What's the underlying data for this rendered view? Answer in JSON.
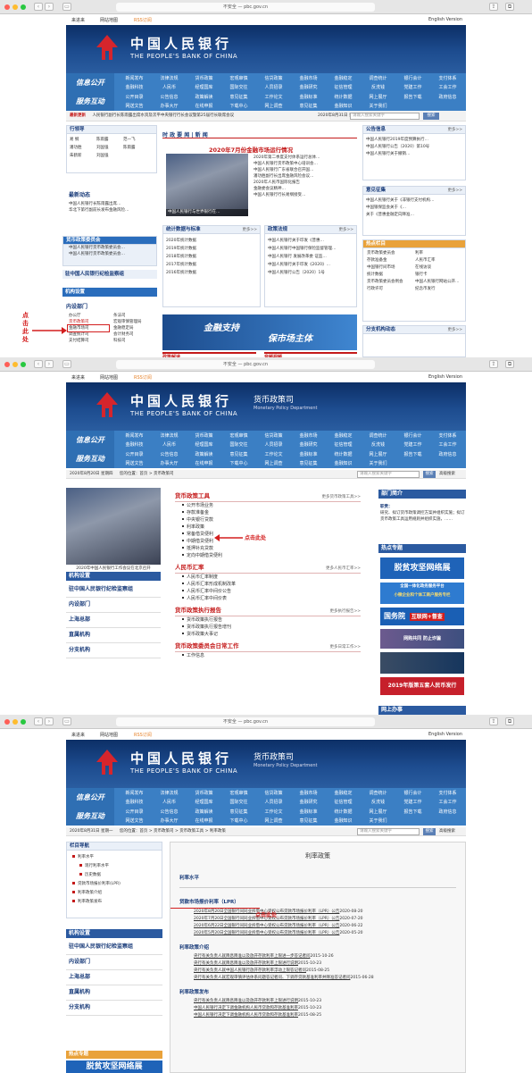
{
  "browser": {
    "url": "不安全 — pbc.gov.cn",
    "english": "English Version"
  },
  "toplinks": {
    "visit": "来进来",
    "sitemap": "网站地图",
    "rss": "RSS订阅",
    "english": "English Version"
  },
  "brand": {
    "cn": "中国人民银行",
    "en": "THE PEOPLE'S BANK OF CHINA",
    "dept_cn": "货币政策司",
    "dept_en": "Monetary Policy Department"
  },
  "menu": {
    "label1": "信息公开",
    "label2": "服务互动",
    "row1": [
      "新闻发布",
      "法律法规",
      "货币政策",
      "宏观审慎",
      "信贷政策",
      "金融市场",
      "金融稳定",
      "调查统计",
      "银行会计",
      "支付体系"
    ],
    "row2": [
      "金融科技",
      "人民币",
      "经理国库",
      "国际交往",
      "人员招录",
      "金融研究",
      "征信管理",
      "反洗钱",
      "党建工作",
      "工会工作"
    ],
    "row3": [
      "公开目录",
      "公告信息",
      "政策解读",
      "意见征集",
      "工作论文",
      "金融标准",
      "统计数据",
      "网上展厅",
      "报告下载",
      "政府信息"
    ],
    "row4": [
      "网送文告",
      "办事大厅",
      "在线申报",
      "下载中心",
      "网上调查",
      "意见征集",
      "金融知识",
      "关于我们",
      "",
      ""
    ]
  },
  "s1": {
    "ticker_label": "最新更新",
    "ticker": "人民银行副行长陈雨露出席水资及次平中央银行行长会议暨第25届行长联席会议",
    "ticker_date": "2020年8月31日 星期一",
    "search_placeholder": "请输入搜索关键字",
    "search_btn": "搜索",
    "leaders_title": "行领导",
    "leaders": [
      "易 纲",
      "陈雨露",
      "范一飞",
      "潘功胜",
      "刘国强",
      "陈雨露",
      "朱鹤新",
      "刘国强"
    ],
    "latest_title": "最新动态",
    "latest": [
      "中国人民银行长陈雨露出席…",
      "华北下第行副前长发布金融风险…"
    ],
    "mpc_title": "货币政策委员会",
    "mpc": [
      "中国人民银行货币政策委员会…",
      "中国人民银行货币政策委员会…"
    ],
    "jijian": "驻中国人民银行纪检监察组",
    "jigou_title": "机构设置",
    "neibu": "内设部门",
    "dept_grid": [
      "办公厅",
      "条法司",
      "货币政策司",
      "宏观审慎管理局",
      "金融市场司",
      "金融稳定局",
      "调查统计司",
      "会计财务司",
      "支付结算司",
      "科技司"
    ],
    "highlight_dept": "货币政策司",
    "annot1": "点击此处",
    "news_title": "时 政 要 闻 | 新 闻",
    "news_headline": "2020年7月份金融市场运行情况",
    "news_list": [
      "2020年第二季度支付体系运行总体…",
      "中国人民银行货币政策中心培训会…",
      "中国人民银行广东省联合召开国…",
      "潘功胜副行长出席金融风险会议…",
      "2020年人民币国际化报告",
      "金融委会议精神…",
      "中国人民银行行长易纲接受…"
    ],
    "photo_caption": "中国人民银行与世界银行在…",
    "stats_title": "统计数据与标准",
    "stats": [
      "2020年统计数据",
      "2019年统计数据",
      "2018年统计数据",
      "2017年统计数据",
      "2016年统计数据"
    ],
    "law_title": "政策法规",
    "law": [
      "中国人民银行关于印发《普惠…",
      "中国人民银行中国银行保险监督管理…",
      "中国人民银行 发展改革委 证监…",
      "中国人民银行关于印发《2020》…",
      "中国人民银行公告〔2020〕1号"
    ],
    "banner_text1": "金融支持",
    "banner_text2": "保市场主体",
    "gongkai_title": "公告信息",
    "gongkai": [
      "中国人民银行2019年度预算执行…",
      "中国人民银行公告〔2020〕第10号",
      "中国人民银行关于撤销…"
    ],
    "yijian_title": "意见征集",
    "yijian": [
      "中国人民银行关于《非银行支付机构…",
      "中国银保监会关于《…",
      "关于《普惠金融定向降准…"
    ],
    "hot_title": "热点栏目",
    "hot": [
      "货币政策委员会",
      "利率",
      "存款准备金",
      "人民币汇率",
      "中国银行间市场",
      "在线访谈",
      "统计数据",
      "银行卡",
      "货币政策委员会例会",
      "中国人民银行网站公开…",
      "行政许可",
      "纪念币发行"
    ],
    "fenzhi_title": "分支机构动态",
    "zhengce": "政策解读",
    "shipin": "音频视频"
  },
  "s2": {
    "date": "2020年8月20日 星期四",
    "crumb": "您的位置：首页 > 货币政策司",
    "search_placeholder": "请输入搜索关键字",
    "search_btn": "搜索",
    "adv": "高级搜索",
    "photo_caption": "2020年中国人民银行工作会议在北京召开",
    "side": [
      "机构设置",
      "驻中国人民银行纪检监察组",
      "内设部门",
      "上海总部",
      "直属机构",
      "分支机构"
    ],
    "tools_title": "货币政策工具",
    "tools_more": "更多货币政策工具>>",
    "tools": [
      "公开市场业务",
      "存款准备金",
      "中央银行贷款",
      "利率政策",
      "常备借贷便利",
      "中期借贷便利",
      "抵押补充贷款",
      "定向中期借贷便利"
    ],
    "annot2": "点击此处",
    "rmb_title": "人民币汇率",
    "rmb_more": "更多人民币汇率>>",
    "rmb": [
      "人民币汇率制度",
      "人民币汇率形成机制改革",
      "人民币汇率中间价公告",
      "人民币汇率中间价表"
    ],
    "report_title": "货币政策执行报告",
    "report_more": "更多执行报告>>",
    "report": [
      "货币政策执行报告",
      "货币政策执行报告增刊",
      "货币政策大事记"
    ],
    "committee_title": "货币政策委员会日常工作",
    "committee_more": "更多日常工作>>",
    "committee": [
      "工作信息"
    ],
    "dept_intro_title": "部门简介",
    "dept_intro_label": "职责：",
    "dept_intro_text": "研究、拟订货币政策调控方案并组织实施；拟订货币政策工具运用规则并组织实施，……",
    "hot_title": "热点专题",
    "promo1": "脱贫攻坚网络展",
    "promo2a": "全国一体化政务服务平台",
    "promo2b": "小微企业和个体工商户服务专栏",
    "promo3": "国务院",
    "promo3b": "互联网+督查",
    "promo4": "网购共同 防止诈骗",
    "promo5": "2019年版第五套人民币发行",
    "wangshang": "网上办事"
  },
  "s3": {
    "date": "2020年8月31日 星期一",
    "crumb": "您的位置：首页 > 货币政策司 > 货币政策工具 > 利率政策",
    "search_placeholder": "请输入搜索关键字",
    "search_btn": "搜索",
    "adv": "高级搜索",
    "nav_title": "栏目导航",
    "nav": [
      "利率水平",
      "现行利率水平",
      "历史数据",
      "贷款市场报价利率(LPR)",
      "利率政策介绍",
      "利率政策发布"
    ],
    "side": [
      "机构设置",
      "驻中国人民银行纪检监察组",
      "内设部门",
      "上海总部",
      "直属机构",
      "分支机构"
    ],
    "hot_title": "热点专题",
    "promo": "脱贫攻坚网络展",
    "page_title": "利率政策",
    "sec1": "利率水平",
    "sec2": "贷款市场报价利率（LPR）",
    "annot3": "点击此处",
    "lpr": [
      {
        "t": "2020年8月20日全国银行间同业拆借中心受权公布贷款市场报价利率（LPR）公告",
        "d": "2020-08-20"
      },
      {
        "t": "2020年7月20日全国银行间同业拆借中心受权公布贷款市场报价利率（LPR）公告",
        "d": "2020-07-20"
      },
      {
        "t": "2020年6月22日全国银行间同业拆借中心受权公布贷款市场报价利率（LPR）公告",
        "d": "2020-06-22"
      },
      {
        "t": "2020年5月20日全国银行间同业拆借中心受权公布贷款市场报价利率（LPR）公告",
        "d": "2020-05-20"
      }
    ],
    "sec3": "利率政策介绍",
    "intro": [
      {
        "t": "央行有关负责人就降息降准以及放开存款利率上限进一步答记者问",
        "d": "2015-10-26"
      },
      {
        "t": "央行有关负责人就降息降准以及放开存款利率上限进行说明",
        "d": "2015-10-23"
      },
      {
        "t": "央行有关负责人就中国人民银行放开存款利率浮动上限答记者问",
        "d": "2015-08-25"
      },
      {
        "t": "央行有关负责人就宏观审慎评估体系问题答记者问、下调存贷款基准利率并降准答记者问",
        "d": "2015-06-28"
      }
    ],
    "sec4": "利率政策发布",
    "release": [
      {
        "t": "央行有关负责人就降息降准以及放开存款利率上限进行说明",
        "d": "2015-10-23"
      },
      {
        "t": "中国人民银行决定下调金融机构人民币贷款和存款基准利率",
        "d": "2015-10-23"
      },
      {
        "t": "中国人民银行决定下调金融机构人民币贷款和存款基准利率",
        "d": "2015-08-25"
      }
    ]
  }
}
